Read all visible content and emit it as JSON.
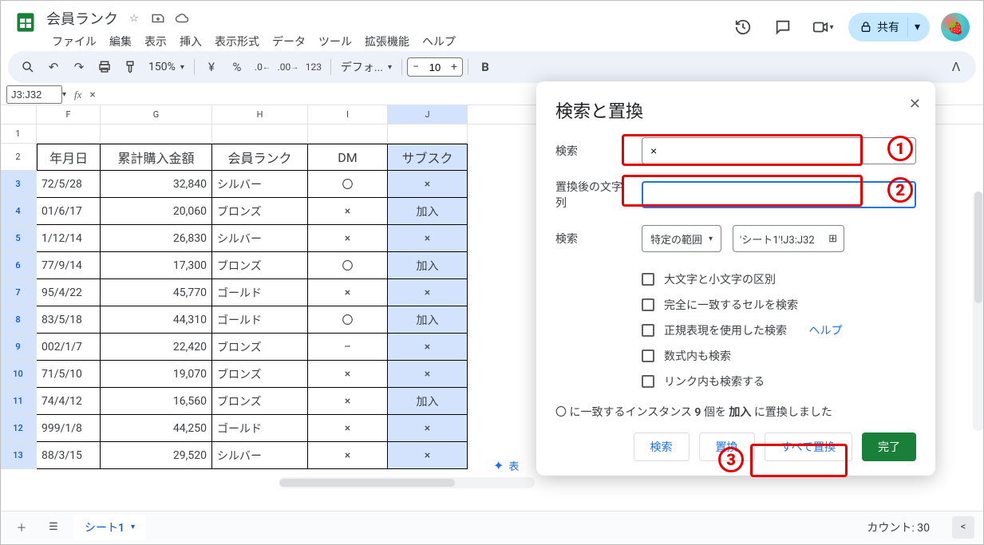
{
  "doc": {
    "title": "会員ランク"
  },
  "menu": {
    "file": "ファイル",
    "edit": "編集",
    "view": "表示",
    "insert": "挿入",
    "format": "表示形式",
    "data": "データ",
    "tools": "ツール",
    "extensions": "拡張機能",
    "help": "ヘルプ"
  },
  "toolbar": {
    "zoom": "150%",
    "currency": "¥",
    "percent": "%",
    "dec_dec": ".0",
    "dec_inc": ".00",
    "num_fmt": "123",
    "font": "デフォ...",
    "font_size": "10"
  },
  "share": {
    "label": "共有"
  },
  "namebox": {
    "value": "J3:J32"
  },
  "columns": {
    "F": "F",
    "G": "G",
    "H": "H",
    "I": "I",
    "J": "J"
  },
  "headers": {
    "F": "年月日",
    "G": "累計購入金額",
    "H": "会員ランク",
    "I": "DM",
    "J": "サブスク"
  },
  "rows": [
    {
      "n": "3",
      "F": "72/5/28",
      "G": "32,840",
      "H": "シルバー",
      "I": "〇",
      "J": "×"
    },
    {
      "n": "4",
      "F": "01/6/17",
      "G": "20,060",
      "H": "ブロンズ",
      "I": "×",
      "J": "加入"
    },
    {
      "n": "5",
      "F": "1/12/14",
      "G": "26,830",
      "H": "シルバー",
      "I": "×",
      "J": "×"
    },
    {
      "n": "6",
      "F": "77/9/14",
      "G": "17,300",
      "H": "ブロンズ",
      "I": "〇",
      "J": "加入"
    },
    {
      "n": "7",
      "F": "95/4/22",
      "G": "45,770",
      "H": "ゴールド",
      "I": "×",
      "J": "×"
    },
    {
      "n": "8",
      "F": "83/5/18",
      "G": "44,310",
      "H": "ゴールド",
      "I": "〇",
      "J": "加入"
    },
    {
      "n": "9",
      "F": "002/1/7",
      "G": "22,420",
      "H": "ブロンズ",
      "I": "–",
      "J": "×"
    },
    {
      "n": "10",
      "F": "71/5/10",
      "G": "19,070",
      "H": "ブロンズ",
      "I": "×",
      "J": "×"
    },
    {
      "n": "11",
      "F": "74/4/12",
      "G": "16,560",
      "H": "ブロンズ",
      "I": "×",
      "J": "加入"
    },
    {
      "n": "12",
      "F": "999/1/8",
      "G": "44,250",
      "H": "ゴールド",
      "I": "×",
      "J": "×"
    },
    {
      "n": "13",
      "F": "88/3/15",
      "G": "29,520",
      "H": "シルバー",
      "I": "×",
      "J": "×"
    }
  ],
  "ai_chip": "表",
  "sheet_tab": {
    "name": "シート1"
  },
  "footer": {
    "count": "カウント: 30"
  },
  "dialog": {
    "title": "検索と置換",
    "find_label": "検索",
    "find_value": "×",
    "replace_label": "置換後の文字列",
    "replace_value": "",
    "scope_label": "検索",
    "scope_value": "特定の範囲",
    "range_value": "'シート1'!J3:J32",
    "opt_case": "大文字と小文字の区別",
    "opt_exact": "完全に一致するセルを検索",
    "opt_regex": "正規表現を使用した検索",
    "opt_regex_help": "ヘルプ",
    "opt_formula": "数式内も検索",
    "opt_link": "リンク内も検索する",
    "status_pre": "〇 に一致するインスタンス ",
    "status_n": "9",
    "status_mid": " 個を ",
    "status_rep": "加入",
    "status_post": " に置換しました",
    "btn_find": "検索",
    "btn_replace": "置換",
    "btn_replace_all": "すべて置換",
    "btn_done": "完了"
  },
  "anno": {
    "n1": "1",
    "n2": "2",
    "n3": "3"
  }
}
